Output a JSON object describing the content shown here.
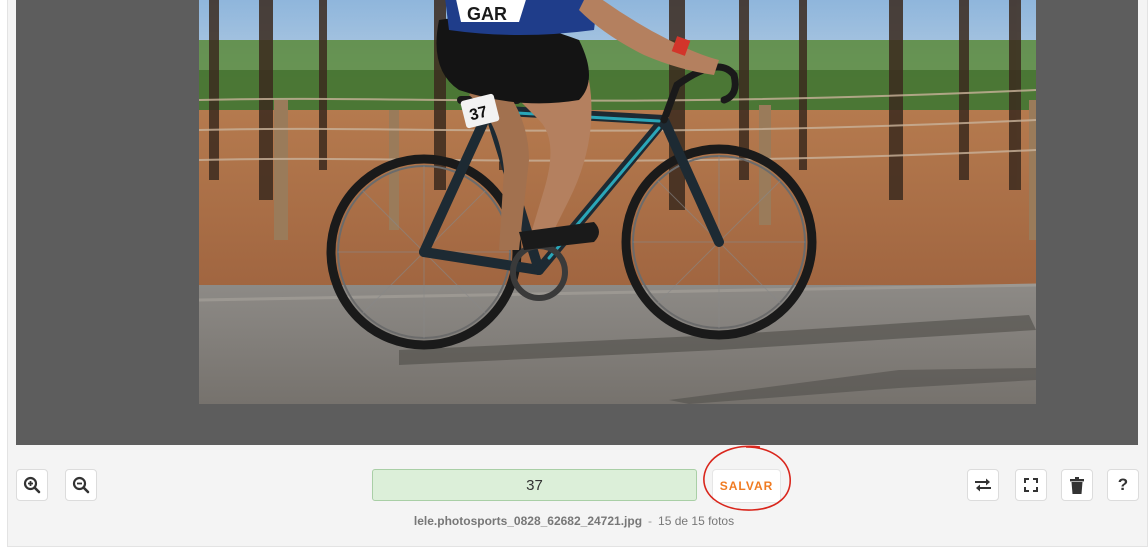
{
  "toolbar": {
    "zoom_in_icon": "zoom-in-icon",
    "zoom_out_icon": "zoom-out-icon",
    "swap_icon": "swap-arrows-icon",
    "fullscreen_icon": "fullscreen-icon",
    "delete_icon": "trash-icon",
    "help_label": "?"
  },
  "tag_input": {
    "value": "37"
  },
  "save_button": {
    "label": "SALVAR"
  },
  "caption": {
    "filename": "lele.photosports_0828_62682_24721.jpg",
    "separator": "-",
    "count": "15 de 15 fotos"
  },
  "photo": {
    "race_number": "37"
  },
  "colors": {
    "save_text": "#f07b22",
    "input_bg": "#dcefd9",
    "annotation": "#d9261c",
    "viewer_bg": "#5d5d5d"
  }
}
